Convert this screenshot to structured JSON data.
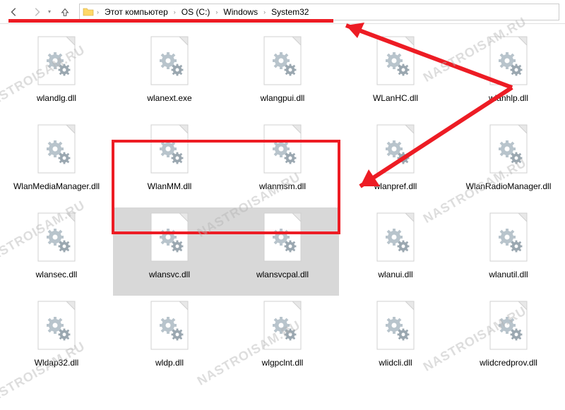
{
  "breadcrumb": {
    "root_sep": "›",
    "items": [
      {
        "label": "Этот компьютер"
      },
      {
        "label": "OS (C:)"
      },
      {
        "label": "Windows"
      },
      {
        "label": "System32"
      }
    ]
  },
  "files": [
    {
      "name": "wlandlg.dll"
    },
    {
      "name": "wlanext.exe"
    },
    {
      "name": "wlangpui.dll"
    },
    {
      "name": "WLanHC.dll"
    },
    {
      "name": "wlanhlp.dll"
    },
    {
      "name": "WlanMediaManager.dll"
    },
    {
      "name": "WlanMM.dll"
    },
    {
      "name": "wlanmsm.dll"
    },
    {
      "name": "wlanpref.dll"
    },
    {
      "name": "WlanRadioManager.dll"
    },
    {
      "name": "wlansec.dll"
    },
    {
      "name": "wlansvc.dll",
      "selected": true
    },
    {
      "name": "wlansvcpal.dll",
      "selected": true
    },
    {
      "name": "wlanui.dll"
    },
    {
      "name": "wlanutil.dll"
    },
    {
      "name": "Wldap32.dll"
    },
    {
      "name": "wldp.dll"
    },
    {
      "name": "wlgpclnt.dll"
    },
    {
      "name": "wlidcli.dll"
    },
    {
      "name": "wlidcredprov.dll"
    }
  ],
  "watermark_text": "NASTROISAM.RU",
  "annotation_color": "#ed1c24"
}
